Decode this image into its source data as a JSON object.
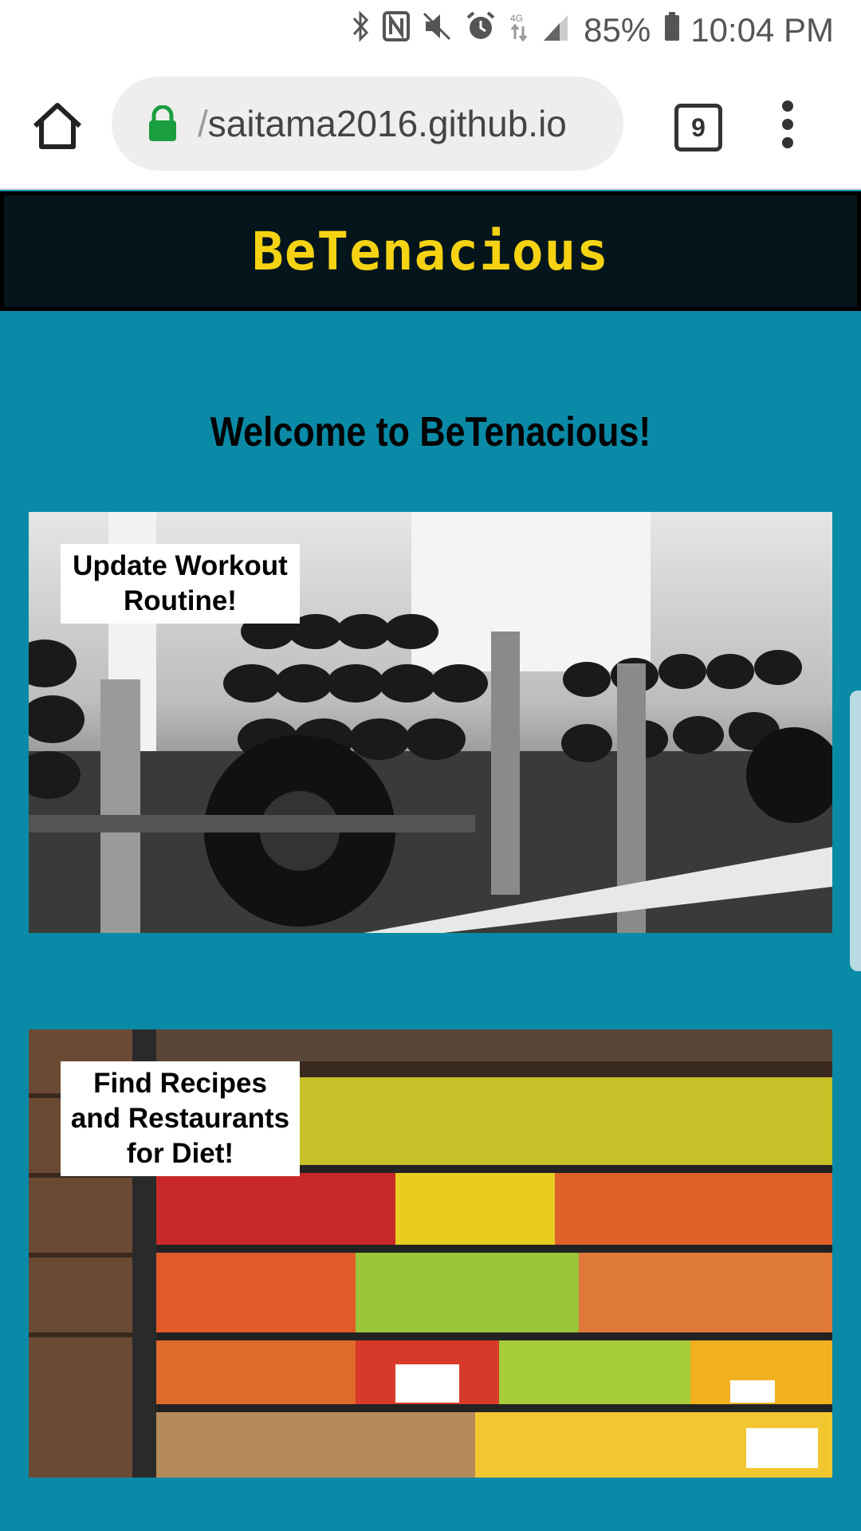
{
  "status_bar": {
    "battery": "85%",
    "time": "10:04 PM",
    "icons": [
      "bluetooth-icon",
      "nfc-icon",
      "mute-icon",
      "alarm-icon",
      "lte-icon",
      "signal-icon",
      "battery-icon"
    ]
  },
  "browser": {
    "url_prefix": "/",
    "url": "saitama2016.github.io",
    "tab_count": "9",
    "lock_color": "#1a9e3f"
  },
  "header": {
    "title": "BeTenacious",
    "title_color": "#f5d313",
    "background": "#04161b"
  },
  "main": {
    "heading": "Welcome to BeTenacious!",
    "background": "#0a8aa6",
    "cards": [
      {
        "label": "Update Workout Routine!",
        "image": "gym-dumbbell-rack"
      },
      {
        "label": "Find Recipes and Restaurants for Diet!",
        "image": "produce-shelves"
      }
    ]
  }
}
